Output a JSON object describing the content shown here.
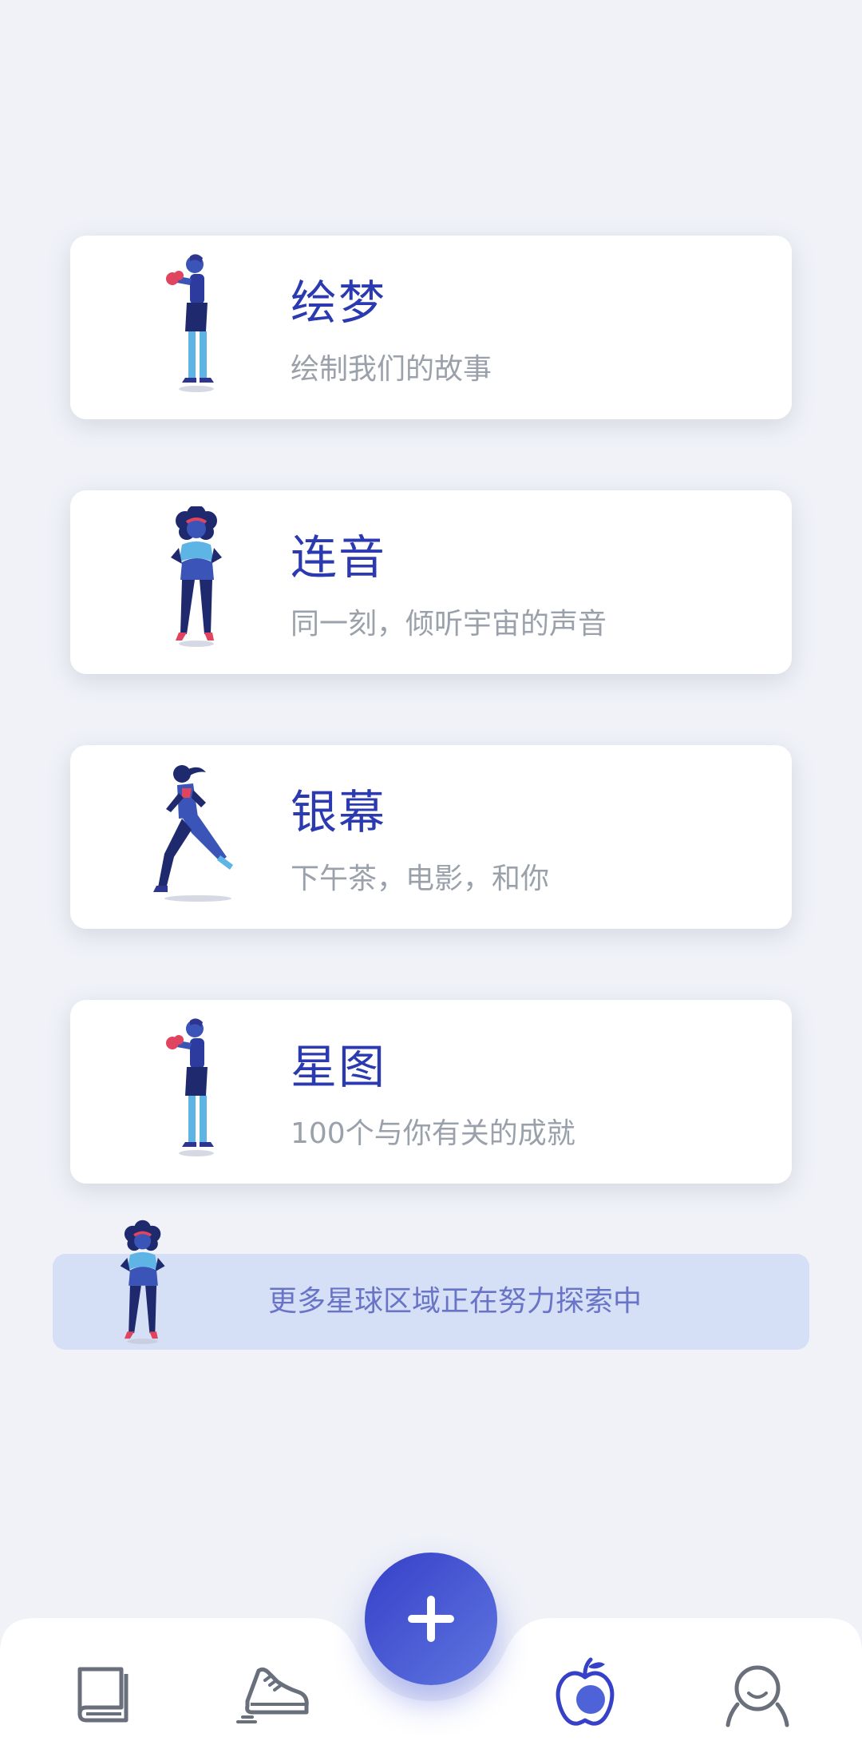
{
  "cards": [
    {
      "title": "绘梦",
      "subtitle": "绘制我们的故事",
      "figure": "boxer-woman-icon"
    },
    {
      "title": "连音",
      "subtitle": "同一刻，倾听宇宙的声音",
      "figure": "curly-hair-woman-icon"
    },
    {
      "title": "银幕",
      "subtitle": "下午茶，电影，和你",
      "figure": "running-woman-icon"
    },
    {
      "title": "星图",
      "subtitle": "100个与你有关的成就",
      "figure": "boxer-woman-icon"
    }
  ],
  "banner": {
    "text": "更多星球区域正在努力探索中",
    "figure": "curly-hair-woman-icon"
  },
  "bottom_nav": {
    "items": [
      {
        "name": "book-icon"
      },
      {
        "name": "sneaker-icon"
      },
      {
        "name": "apple-icon",
        "active": true
      },
      {
        "name": "profile-icon"
      }
    ],
    "fab_icon": "plus-icon"
  },
  "colors": {
    "background": "#f0f2f8",
    "title": "#2b3ab0",
    "subtitle": "#9aa1ab",
    "banner_bg": "#d5dff6",
    "banner_text": "#6a74c6",
    "fab": "#3f4fd0"
  }
}
